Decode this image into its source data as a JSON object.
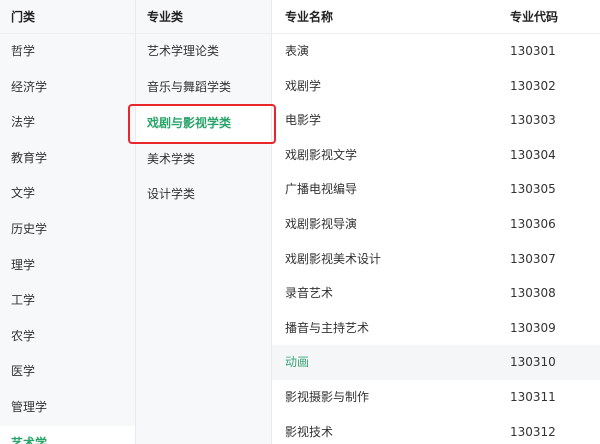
{
  "categories": {
    "header": "门类",
    "items": [
      "哲学",
      "经济学",
      "法学",
      "教育学",
      "文学",
      "历史学",
      "理学",
      "工学",
      "农学",
      "医学",
      "管理学",
      "艺术学"
    ],
    "active_index": 11
  },
  "subcategories": {
    "header": "专业类",
    "items": [
      "艺术学理论类",
      "音乐与舞蹈学类",
      "戏剧与影视学类",
      "美术学类",
      "设计学类"
    ],
    "active_index": 2
  },
  "majors": {
    "header_name": "专业名称",
    "header_code": "专业代码",
    "rows": [
      {
        "name": "表演",
        "code": "130301"
      },
      {
        "name": "戏剧学",
        "code": "130302"
      },
      {
        "name": "电影学",
        "code": "130303"
      },
      {
        "name": "戏剧影视文学",
        "code": "130304"
      },
      {
        "name": "广播电视编导",
        "code": "130305"
      },
      {
        "name": "戏剧影视导演",
        "code": "130306"
      },
      {
        "name": "戏剧影视美术设计",
        "code": "130307"
      },
      {
        "name": "录音艺术",
        "code": "130308"
      },
      {
        "name": "播音与主持艺术",
        "code": "130309"
      },
      {
        "name": "动画",
        "code": "130310"
      },
      {
        "name": "影视摄影与制作",
        "code": "130311"
      },
      {
        "name": "影视技术",
        "code": "130312"
      }
    ],
    "highlighted_index": 9
  },
  "colors": {
    "accent_green": "#29a36a",
    "selection_border": "#e8262b"
  }
}
